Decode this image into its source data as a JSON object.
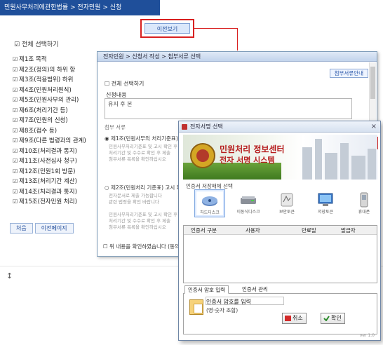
{
  "base": {
    "title": "민원사무처리에관한법률 > 전자민원 > 신청",
    "button_label": "이전보기",
    "check_all": "전체 선택하기",
    "items": [
      "제1조 목적",
      "제2조(정의)의 하위 항",
      "제3조(적용범위) 하위",
      "제4조(민원처리원칙)",
      "제5조(민원사무의 관리)",
      "제6조(처리기간 등)",
      "제7조(민원의 신청)",
      "제8조(접수 등)",
      "제9조(다른 법령과의 관계)",
      "제10조(처리결과 통지)",
      "제11조(사전심사 청구)",
      "제12조(민원1회 방문)",
      "제13조(처리기간 계산)",
      "제14조(처리결과 통지)",
      "제15조(전자민원 처리)"
    ],
    "nav": [
      "처음",
      "이전페이지"
    ],
    "footer_mark": "↕"
  },
  "mid": {
    "title": "전자민원 > 신청서 작성 > 첨부서류 선택",
    "link_label": "첨부서류안내",
    "check_label": "전체 선택하기",
    "field_label": "신청내용",
    "textarea_value": "유지 후 본",
    "sub_label": "첨부 서류",
    "item1": "제1조(민원사무의 처리기준표) 확인",
    "item2": "제2조(민원처리 기준표) 고시 확인",
    "para1": "민원사무처리기준표 및 고시 확인 후 신청",
    "para2": "처리기간 및 수수료 확인 후 제출",
    "para3": "첨부서류 목록을 확인하십시오",
    "para4": "전자문서로 제출 가능합니다",
    "para5": "관련 법령을 확인 바랍니다",
    "bottom_check": "위 내용을 확인하였습니다 (동의)"
  },
  "front": {
    "title": "전자서명 선택",
    "close_label": "×",
    "banner_line1": "민원처리 정보센터",
    "banner_line2": "전자 서명 시스템",
    "section_label": "인증서 저장매체 선택",
    "devices": [
      "하드디스크",
      "이동식디스크",
      "보안토큰",
      "저장토큰",
      "휴대폰"
    ],
    "table_headers": [
      "인증서 구분",
      "사용자",
      "만료일",
      "발급자"
    ],
    "tab_active": "인증서 암호 입력",
    "tab_other": "인증서 관리",
    "panel_line1": "인증서 암호를 입력",
    "panel_line2": "(영·숫자 조합)",
    "cancel_label": "취소",
    "confirm_label": "확인",
    "corner_note": "ver 1.0"
  },
  "colors": {
    "title_bar": "#1f4f9a",
    "highlight_red": "#d82020",
    "banner_green": "#4f8b2a",
    "banner_text": "#b61d1d"
  }
}
